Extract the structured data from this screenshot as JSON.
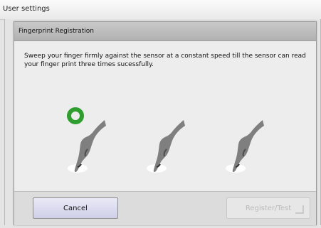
{
  "window": {
    "title": "User settings"
  },
  "dialog": {
    "title": "Fingerprint Registration",
    "instruction": "Sweep your finger firmly against the sensor at a constant speed till the sensor can read your finger print three times sucessfully.",
    "steps": [
      {
        "state": "done",
        "status_icon": "check-circle-icon"
      },
      {
        "state": "pending"
      },
      {
        "state": "pending"
      }
    ],
    "colors": {
      "success": "#2e9e2e"
    },
    "buttons": {
      "cancel": "Cancel",
      "register": "Register/Test"
    }
  }
}
